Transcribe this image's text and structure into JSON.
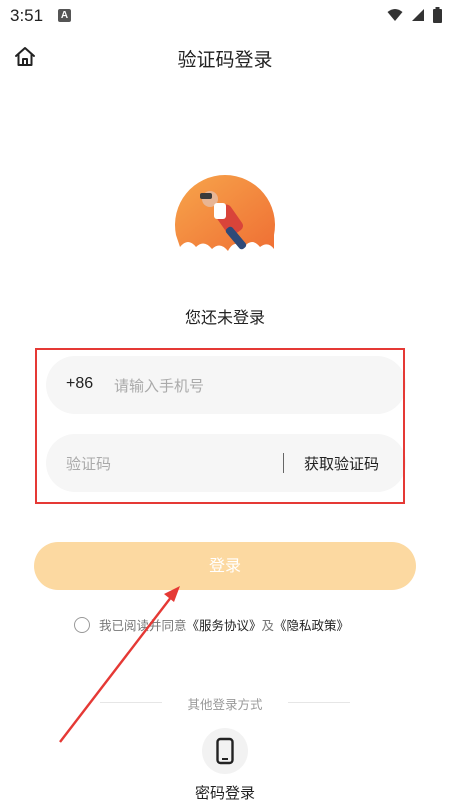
{
  "status_bar": {
    "time": "3:51",
    "notification_letter": "A"
  },
  "header": {
    "title": "验证码登录"
  },
  "main": {
    "subtitle": "您还未登录",
    "phone": {
      "country_code": "+86",
      "placeholder": "请输入手机号"
    },
    "code": {
      "placeholder": "验证码",
      "get_code_label": "获取验证码"
    },
    "login_label": "登录",
    "agreement": {
      "prefix": "我已阅读并同意",
      "terms": "《服务协议》",
      "and": "及",
      "privacy": "《隐私政策》"
    },
    "other_methods_label": "其他登录方式",
    "password_login_label": "密码登录"
  },
  "colors": {
    "accent": "#fcd9a1",
    "illustration_orange": "#f28a3c",
    "annotation_red": "#e53935"
  },
  "icons": [
    "home-icon",
    "wifi-icon",
    "signal-icon",
    "battery-icon",
    "phone-icon"
  ]
}
